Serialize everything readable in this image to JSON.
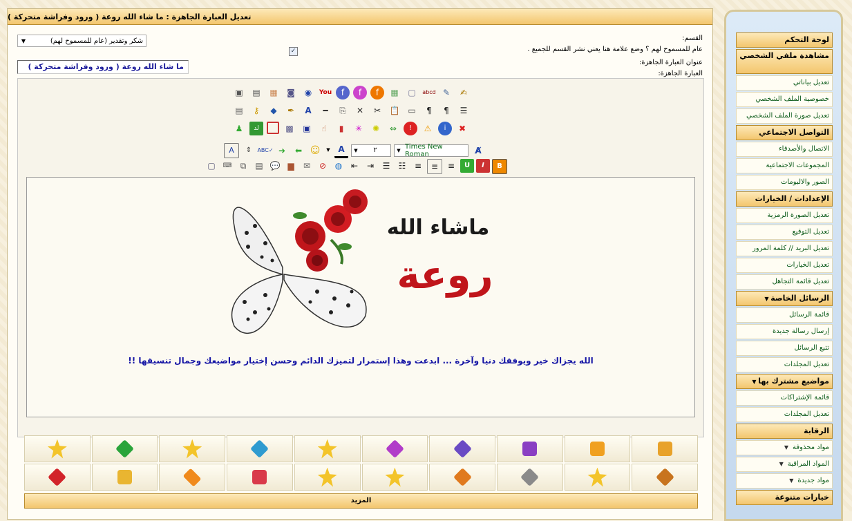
{
  "header": {
    "title": "تعديل العبارة الجاهزة : ما شاء الله روعة ( ورود وفراشة متحركة )"
  },
  "form": {
    "section_label": "القسم:",
    "section_select": "شكر وتقدير (عام للمسموح لهم)",
    "public_note": "عام للمسموح لهم ؟ وضع علامة هنا يعني نشر القسم للجميع .",
    "title_label": "عنوان العبارة الجاهزة:",
    "title_value": "ما شاء الله روعة ( ورود وفراشة متحركة )",
    "body_label": "العبارة الجاهزة:"
  },
  "toolbar": {
    "font_name": "Times New Roman",
    "font_size": "٢"
  },
  "content": {
    "image_line1": "ماشاء الله",
    "image_line2": "روعة",
    "message": "الله يجزاك خير ويوفقك دنيا وآخرة ... ابدعت وهذا إستمرار لتميزك الدائم وحسن إختيار مواضيعك وجمال تنسيقها !!"
  },
  "smilies": {
    "more_label": "المزيد"
  },
  "sidebar": {
    "sections": [
      {
        "title": "لوحة التحكم",
        "items": []
      },
      {
        "title": "مشاهدة ملفي الشخصي",
        "items": [
          "تعديل بياناتي",
          "خصوصية الملف الشخصي",
          "تعديل صورة الملف الشخصي"
        ]
      },
      {
        "title": "التواصل الاجتماعي",
        "items": [
          "الاتصال والأصدقاء",
          "المجموعات الاجتماعية",
          "الصور والالبومات"
        ]
      },
      {
        "title": "الإعدادات / الخيارات",
        "items": [
          "تعديل الصورة الرمزية",
          "تعديل التوقيع",
          "تعديل البريد // كلمة المرور",
          "تعديل الخيارات",
          "تعديل قائمة التجاهل"
        ]
      },
      {
        "title": "الرسائل الخاصة",
        "items": [
          "قائمة الرسائل",
          "إرسال رسالة جديدة",
          "تتبع الرسائل",
          "تعديل المجلدات"
        ]
      },
      {
        "title": "مواضيع مشترك بها",
        "items": [
          "قائمة الإشتراكات",
          "تعديل المجلدات"
        ]
      },
      {
        "title": "الرقابة",
        "items": [
          "مواد محذوفة",
          "المواد المراقبة",
          "مواد جديدة"
        ]
      },
      {
        "title": "خيارات متنوعة",
        "items": []
      }
    ]
  },
  "colors": {
    "accent": "#f3c66e",
    "link": "#0b5a19",
    "message": "#1515a5"
  }
}
